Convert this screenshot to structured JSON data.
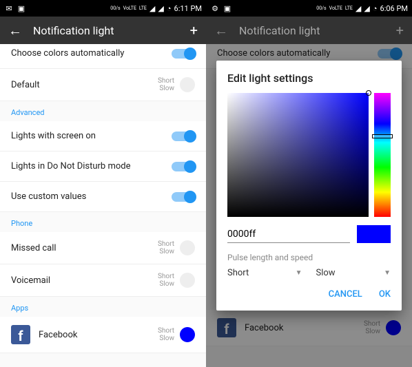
{
  "left": {
    "statusbar": {
      "time": "6:11 PM",
      "net": "00/s",
      "volte": "VoLTE",
      "lte": "LTE"
    },
    "appbar": {
      "title": "Notification light"
    },
    "rows": {
      "auto": "Choose colors automatically",
      "default": "Default",
      "default_sub1": "Short",
      "default_sub2": "Slow"
    },
    "advanced": {
      "header": "Advanced",
      "screen_on": "Lights with screen on",
      "dnd": "Lights in Do Not Disturb mode",
      "custom": "Use custom values"
    },
    "phone": {
      "header": "Phone",
      "missed": "Missed call",
      "missed_sub1": "Short",
      "missed_sub2": "Slow",
      "voicemail": "Voicemail",
      "vm_sub1": "Short",
      "vm_sub2": "Slow"
    },
    "apps": {
      "header": "Apps",
      "fb": "Facebook",
      "fb_sub1": "Short",
      "fb_sub2": "Slow",
      "fb_color": "#0000ff"
    }
  },
  "right": {
    "statusbar": {
      "time": "6:06 PM",
      "net": "00/s",
      "volte": "VoLTE",
      "lte": "LTE"
    },
    "appbar": {
      "title": "Notification light"
    },
    "bg": {
      "auto": "Choose colors automatically",
      "fb": "Facebook",
      "fb_sub1": "Short",
      "fb_sub2": "Slow"
    },
    "dialog": {
      "title": "Edit light settings",
      "hex": "0000ff",
      "preview_color": "#0000ff",
      "pulse_label": "Pulse length and speed",
      "length": "Short",
      "speed": "Slow",
      "cancel": "CANCEL",
      "ok": "OK"
    }
  }
}
